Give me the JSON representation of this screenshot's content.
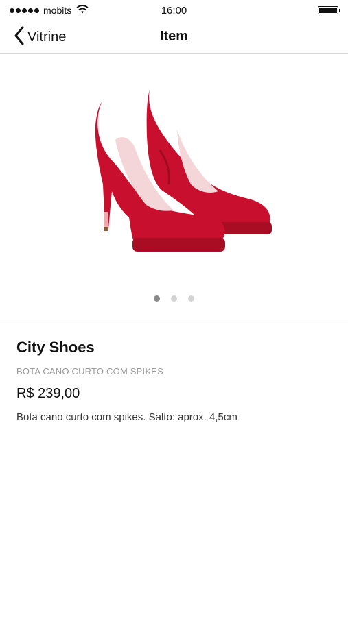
{
  "status_bar": {
    "carrier": "mobits",
    "time": "16:00",
    "icons": [
      "signal-dots-icon",
      "wifi-icon",
      "battery-icon"
    ]
  },
  "nav": {
    "back_label": "Vitrine",
    "title": "Item",
    "back_icon": "chevron-left-icon"
  },
  "carousel": {
    "image": "red-high-heel-pumps",
    "page_count": 3,
    "active_page": 1
  },
  "product": {
    "brand": "City Shoes",
    "subtitle": "BOTA CANO CURTO COM SPIKES",
    "price": "R$ 239,00",
    "description": "Bota cano curto com spikes. Salto: aprox. 4,5cm"
  },
  "colors": {
    "accent_red": "#c8102e",
    "divider": "#d8d8d8"
  }
}
